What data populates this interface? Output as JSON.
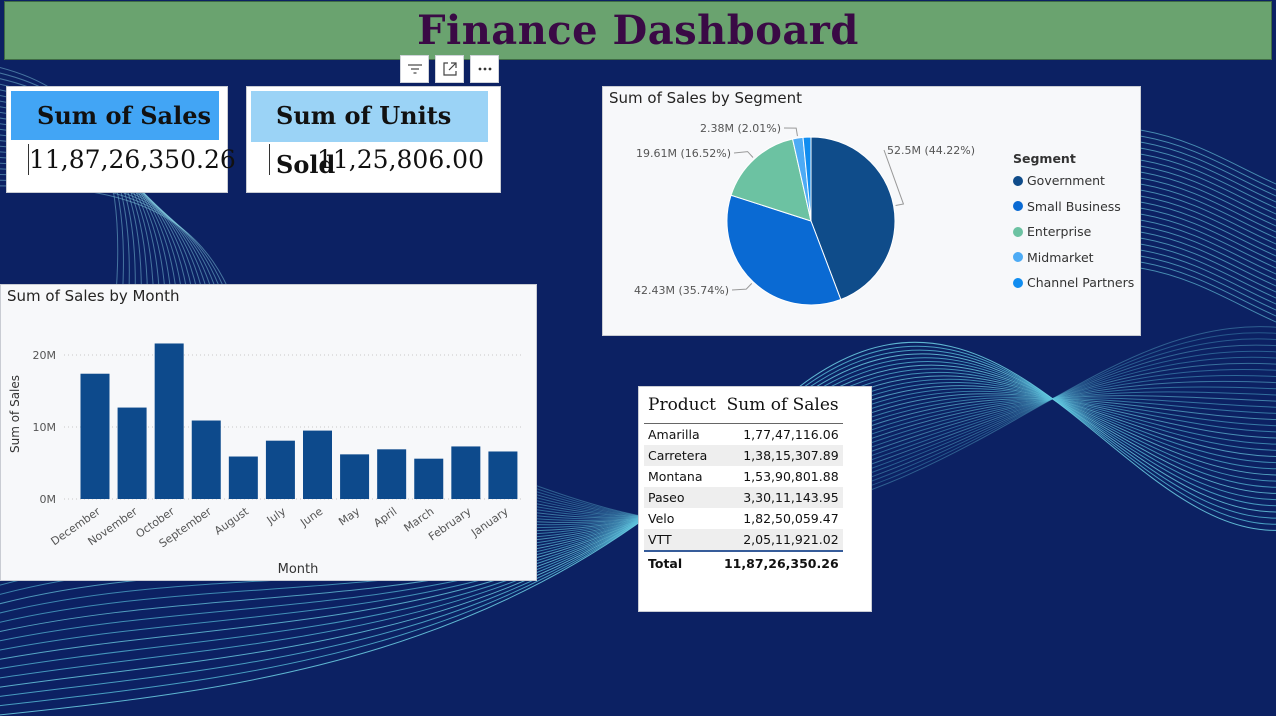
{
  "dashboard": {
    "title": "Finance Dashboard"
  },
  "visual_header": {
    "icons": [
      "filter-icon",
      "focus-mode-icon",
      "more-options-icon"
    ]
  },
  "kpi_sales": {
    "label": "Sum of Sales",
    "value": "11,87,26,350.26"
  },
  "kpi_units": {
    "label": "Sum of Units Sold",
    "value": "11,25,806.00"
  },
  "colors": {
    "bar": "#0d4a8c",
    "header_blue": "#42a5f5",
    "header_light": "#9bd3f6",
    "title_bg": "#6aa36f",
    "title_text": "#3a0a45",
    "page_bg": "#0c2163"
  },
  "month_chart": {
    "title": "Sum of Sales by Month",
    "chart_data": {
      "type": "bar",
      "title": "Sum of Sales by Month",
      "xlabel": "Month",
      "ylabel": "Sum of Sales",
      "categories": [
        "December",
        "November",
        "October",
        "September",
        "August",
        "July",
        "June",
        "May",
        "April",
        "March",
        "February",
        "January"
      ],
      "values": [
        17.4,
        12.7,
        21.6,
        10.9,
        5.9,
        8.1,
        9.5,
        6.2,
        6.9,
        5.6,
        7.3,
        6.6
      ],
      "value_unit": "M",
      "yticks": [
        "0M",
        "10M",
        "20M"
      ],
      "ylim": [
        0,
        22
      ],
      "grid": true
    }
  },
  "segment_chart": {
    "title": "Sum of Sales by Segment",
    "legend_title": "Segment",
    "chart_data": {
      "type": "pie",
      "title": "Sum of Sales by Segment",
      "slices": [
        {
          "name": "Government",
          "value": 52.5,
          "label": "52.5M (44.22%)",
          "color": "#0f4c8a"
        },
        {
          "name": "Small Business",
          "value": 42.43,
          "label": "42.43M (35.74%)",
          "color": "#0a6ad3"
        },
        {
          "name": "Enterprise",
          "value": 19.61,
          "label": "19.61M (16.52%)",
          "color": "#6cc2a2"
        },
        {
          "name": "Midmarket",
          "value": 2.38,
          "label": "2.38M (2.01%)",
          "color": "#4dabf5"
        },
        {
          "name": "Channel Partners",
          "value": 1.8,
          "label": "",
          "color": "#118df0"
        }
      ],
      "legend_position": "right"
    }
  },
  "product_table": {
    "headers": [
      "Product",
      "Sum of Sales"
    ],
    "rows": [
      [
        "Amarilla",
        "1,77,47,116.06"
      ],
      [
        "Carretera",
        "1,38,15,307.89"
      ],
      [
        "Montana",
        "1,53,90,801.88"
      ],
      [
        "Paseo",
        "3,30,11,143.95"
      ],
      [
        "Velo",
        "1,82,50,059.47"
      ],
      [
        "VTT",
        "2,05,11,921.02"
      ]
    ],
    "total": [
      "Total",
      "11,87,26,350.26"
    ]
  }
}
